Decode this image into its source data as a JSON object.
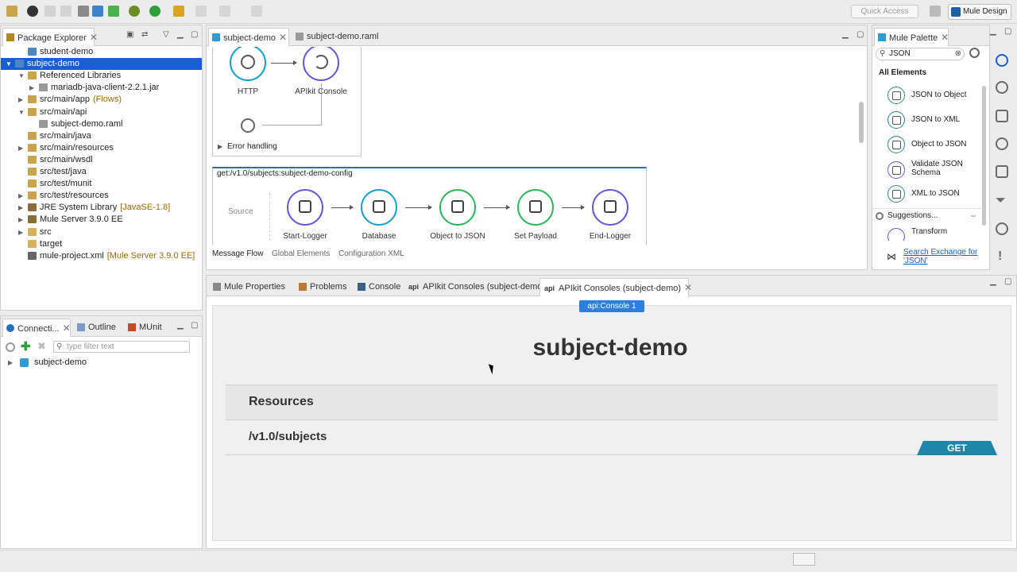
{
  "toolbar": {
    "quick_access_placeholder": "Quick Access",
    "perspective_label": "Mule Design"
  },
  "package_explorer": {
    "tab_label": "Package Explorer",
    "items": [
      {
        "label": "student-demo",
        "decoration": ""
      },
      {
        "label": "subject-demo",
        "decoration": ""
      },
      {
        "label": "Referenced Libraries",
        "decoration": ""
      },
      {
        "label": "mariadb-java-client-2.2.1.jar",
        "decoration": ""
      },
      {
        "label": "src/main/app",
        "decoration": "(Flows)"
      },
      {
        "label": "src/main/api",
        "decoration": ""
      },
      {
        "label": "subject-demo.raml",
        "decoration": ""
      },
      {
        "label": "src/main/java",
        "decoration": ""
      },
      {
        "label": "src/main/resources",
        "decoration": ""
      },
      {
        "label": "src/main/wsdl",
        "decoration": ""
      },
      {
        "label": "src/test/java",
        "decoration": ""
      },
      {
        "label": "src/test/munit",
        "decoration": ""
      },
      {
        "label": "src/test/resources",
        "decoration": ""
      },
      {
        "label": "JRE System Library",
        "decoration": "[JavaSE-1.8]"
      },
      {
        "label": "Mule Server 3.9.0 EE",
        "decoration": ""
      },
      {
        "label": "src",
        "decoration": ""
      },
      {
        "label": "target",
        "decoration": ""
      },
      {
        "label": "mule-project.xml",
        "decoration": "[Mule Server 3.9.0 EE]"
      }
    ]
  },
  "connections": {
    "tabs": [
      "Connecti...",
      "Outline",
      "MUnit"
    ],
    "filter_placeholder": "type filter text",
    "items": [
      "subject-demo"
    ]
  },
  "editor": {
    "tabs": [
      "subject-demo",
      "subject-demo.raml"
    ],
    "flow1": {
      "nodes": [
        "HTTP",
        "APIkit Console"
      ],
      "error_handling": "Error handling"
    },
    "flow2": {
      "title": "get:/v1.0/subjects:subject-demo-config",
      "source_label": "Source",
      "nodes": [
        "Start-Logger",
        "Database",
        "Object to JSON",
        "Set Payload",
        "End-Logger"
      ]
    },
    "bottom_tabs": [
      "Message Flow",
      "Global Elements",
      "Configuration XML"
    ]
  },
  "palette": {
    "tab_label": "Mule Palette",
    "search_value": "JSON",
    "section_title": "All Elements",
    "items": [
      "JSON to Object",
      "JSON to XML",
      "Object to JSON",
      "Validate JSON Schema",
      "XML to JSON"
    ],
    "suggestions_label": "Suggestions...",
    "suggestion_item": "Transform",
    "exchange_link": "Search Exchange for 'JSON'"
  },
  "bottom_panel": {
    "tabs": [
      "Mule Properties",
      "Problems",
      "Console",
      "APIkit Consoles (subject-demo)",
      "APIkit Consoles (subject-demo)"
    ],
    "tab_prefix": "api",
    "console_badge": "api:Console 1",
    "api_title": "subject-demo",
    "resources_heading": "Resources",
    "resource_path": "/v1.0/subjects",
    "method": "GET"
  },
  "colors": {
    "selection": "#1a5ed6",
    "http_accent": "#17a2c4",
    "logger_accent": "#6b55d6",
    "transform_accent": "#2db55d",
    "method_badge": "#1e86a8"
  }
}
